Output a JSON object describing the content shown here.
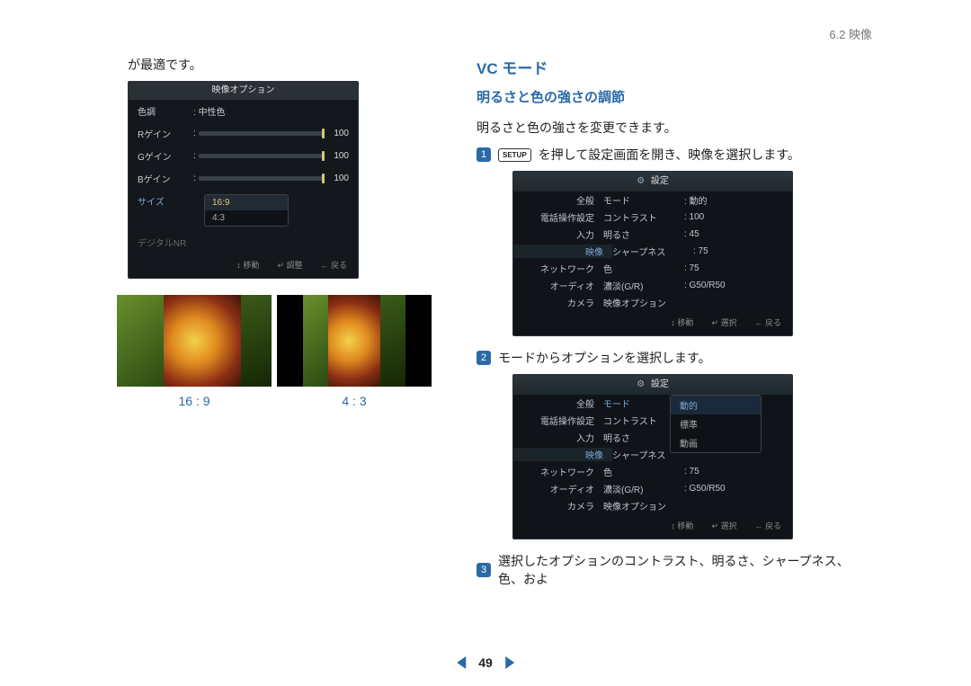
{
  "header": {
    "section": "6.2 映像"
  },
  "pageNav": {
    "number": "49"
  },
  "left": {
    "intro": "が最適です。",
    "osd": {
      "title": "映像オプション",
      "rows": {
        "hue": {
          "label": "色調",
          "value": "中性色"
        },
        "rgain": {
          "label": "Rゲイン",
          "value": "100"
        },
        "ggain": {
          "label": "Gゲイン",
          "value": "100"
        },
        "bgain": {
          "label": "Bゲイン",
          "value": "100"
        },
        "size": {
          "label": "サイズ",
          "opt1": "16:9",
          "opt2": "4:3"
        },
        "dnr": {
          "label": "デジタルNR"
        }
      },
      "footer": {
        "move": "↕ 移動",
        "enter": "↵ 調整",
        "back": "← 戻る"
      }
    },
    "ratios": {
      "wide": "16 : 9",
      "std": "4 : 3"
    }
  },
  "right": {
    "title1": "VC モード",
    "title2": "明るさと色の強さの調節",
    "desc": "明るさと色の強さを変更できます。",
    "step1": {
      "text_before": "",
      "text_key": "SETUP",
      "text_after": "を押して設定画面を開き、映像を選択します。"
    },
    "step2": {
      "text": "モードからオプションを選択します。"
    },
    "step3": {
      "text": "選択したオプションのコントラスト、明るさ、シャープネス、色、およ"
    },
    "osdFooter": {
      "move": "↕ 移動",
      "select": "↵ 選択",
      "back": "← 戻る"
    },
    "osdA": {
      "title": "設定",
      "side": {
        "i0": "全般",
        "i1": "電話操作設定",
        "i2": "入力",
        "i3": "映像",
        "i4": "ネットワーク",
        "i5": "オーディオ",
        "i6": "カメラ"
      },
      "rows": {
        "mode": {
          "label": "モード",
          "value": ": 動的"
        },
        "contrast": {
          "label": "コントラスト",
          "value": ": 100"
        },
        "bright": {
          "label": "明るさ",
          "value": ": 45"
        },
        "sharp": {
          "label": "シャープネス",
          "value": ": 75"
        },
        "color": {
          "label": "色",
          "value": ": 75"
        },
        "gr": {
          "label": "濃淡(G/R)",
          "value": ": G50/R50"
        },
        "videoOpt": {
          "label": "映像オプション",
          "value": ""
        }
      }
    },
    "osdB": {
      "title": "設定",
      "popover": {
        "o0": "動的",
        "o1": "標準",
        "o2": "動画"
      },
      "side": {
        "i0": "全般",
        "i1": "電話操作設定",
        "i2": "入力",
        "i3": "映像",
        "i4": "ネットワーク",
        "i5": "オーディオ",
        "i6": "カメラ"
      },
      "rows": {
        "mode": {
          "label": "モード",
          "value": ""
        },
        "contrast": {
          "label": "コントラスト",
          "value": ""
        },
        "bright": {
          "label": "明るさ",
          "value": ""
        },
        "sharp": {
          "label": "シャープネス",
          "value": ""
        },
        "color": {
          "label": "色",
          "value": ": 75"
        },
        "gr": {
          "label": "濃淡(G/R)",
          "value": ": G50/R50"
        },
        "videoOpt": {
          "label": "映像オプション",
          "value": ""
        }
      }
    }
  }
}
